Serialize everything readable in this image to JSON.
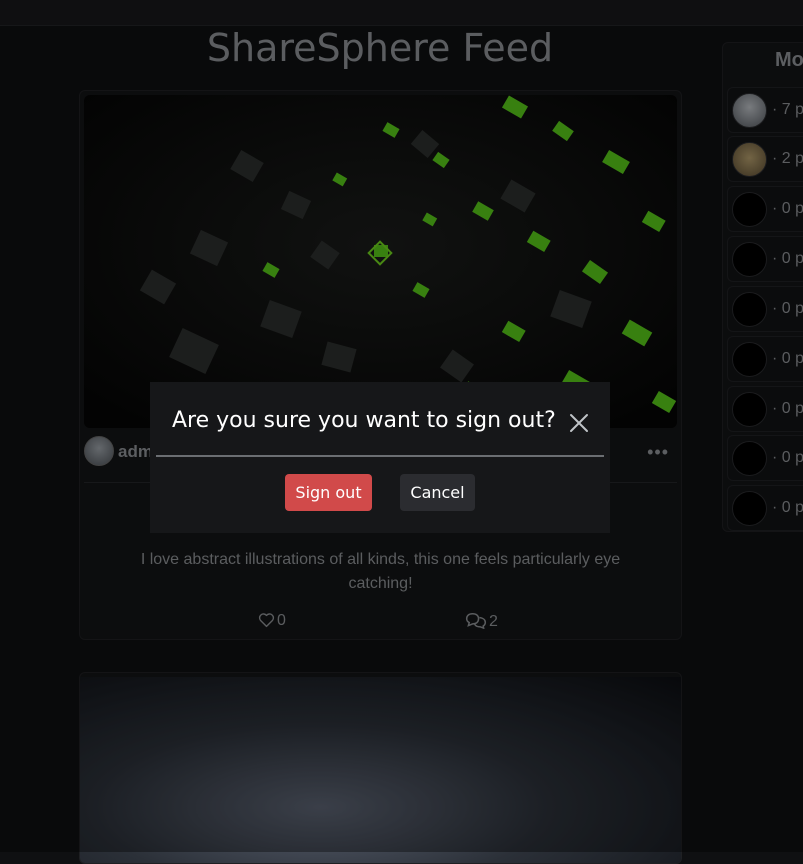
{
  "feed": {
    "title": "ShareSphere Feed",
    "posts": [
      {
        "author": "adm",
        "text": "I love abstract illustrations of all kinds, this one feels particularly eye catching!",
        "likes": "0",
        "comments": "2"
      }
    ]
  },
  "sidebar": {
    "title": "Mo",
    "items": [
      {
        "count": "· 7 p"
      },
      {
        "count": "· 2 p"
      },
      {
        "count": "· 0 p"
      },
      {
        "count": "· 0 p"
      },
      {
        "count": "· 0 p"
      },
      {
        "count": "· 0 p"
      },
      {
        "count": "· 0 p"
      },
      {
        "count": "· 0 p"
      },
      {
        "count": "· 0 p"
      }
    ]
  },
  "modal": {
    "title": "Are you sure you want to sign out?",
    "confirm_label": "Sign out",
    "cancel_label": "Cancel"
  },
  "colors": {
    "danger": "#d14a4a",
    "accent_green": "#6fd11e",
    "background": "#0f1012"
  }
}
